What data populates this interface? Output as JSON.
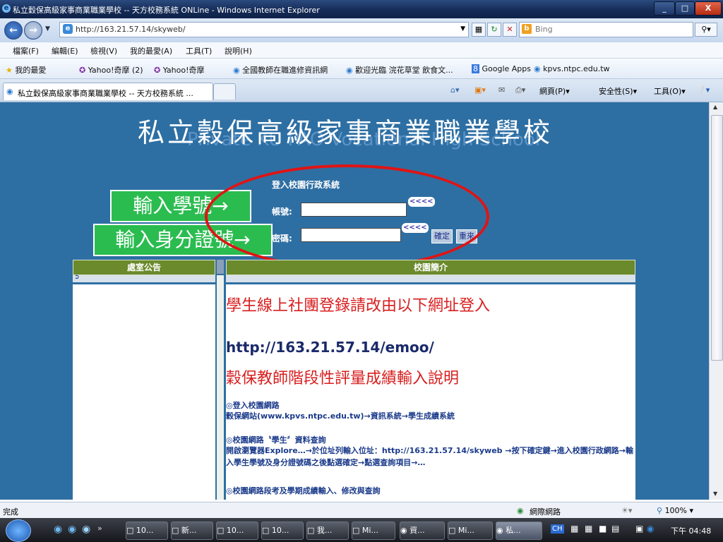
{
  "window": {
    "title": "私立穀保高級家事商業職業學校 -- 天方校務系統 ONLine - Windows Internet Explorer",
    "buttons": [
      "_",
      "□",
      "X"
    ]
  },
  "address": {
    "url": "http://163.21.57.14/skyweb/",
    "search_placeholder": "Bing"
  },
  "menu": {
    "items": [
      "檔案(F)",
      "編輯(E)",
      "檢視(V)",
      "我的最愛(A)",
      "工具(T)",
      "說明(H)"
    ]
  },
  "favorites": {
    "label": "我的最愛",
    "items": [
      "Yahoo!奇摩 (2)",
      "Yahoo!奇摩",
      "全國教師在職進修資訊網",
      "歡迎光臨 浣花草堂 飲食文...",
      "Google Apps",
      "kpvs.ntpc.edu.tw"
    ]
  },
  "tabs": {
    "active": "私立穀保高級家事商業職業學校 -- 天方校務系統 ...",
    "commands": [
      "網頁(P)",
      "安全性(S)",
      "工具(O)"
    ]
  },
  "page": {
    "school_name": "私立穀保高級家事商業職業學校",
    "school_name_en": "Private KU PAO Vocational High School",
    "login": {
      "title": "登入校園行政系統",
      "account_label": "帳號:",
      "password_label": "密碼:",
      "arrow": "<<<<",
      "confirm": "確定",
      "reset": "重來"
    },
    "annotations": {
      "student_id": "輸入學號→",
      "id_number": "輸入身分證號→"
    },
    "left_panel": {
      "header": "處室公告",
      "arrow": "➲"
    },
    "right_panel": {
      "header": "校園簡介",
      "notice1": "學生線上社團登錄請改由以下網址登入",
      "url": "http://163.21.57.14/emoo/",
      "notice2": "穀保教師階段性評量成績輸入說明",
      "sections": [
        {
          "head": "◎登入校園網路",
          "text": "穀保網站(www.kpvs.ntpc.edu.tw)→資訊系統→學生成績系統"
        },
        {
          "head": "◎校園網路〝學生〞資料查詢",
          "text": "開啟瀏覽器Explore…→於位址列輸入位址：http://163.21.57.14/skyweb →按下確定鍵→進入校園行政網路→輸入學生學號及身分證號碼之後點選確定→點選查詢項目→…"
        },
        {
          "head": "◎校園網路段考及學期成績輸入、修改與查詢",
          "text": ""
        }
      ]
    }
  },
  "status": {
    "left": "完成",
    "zone": "網際網路",
    "zoom": "100%"
  },
  "taskbar": {
    "items": [
      "10...",
      "新...",
      "10...",
      "10...",
      "我...",
      "Mi...",
      "資...",
      "Mi...",
      "私..."
    ],
    "lang": "CH",
    "time": "下午 04:48"
  }
}
